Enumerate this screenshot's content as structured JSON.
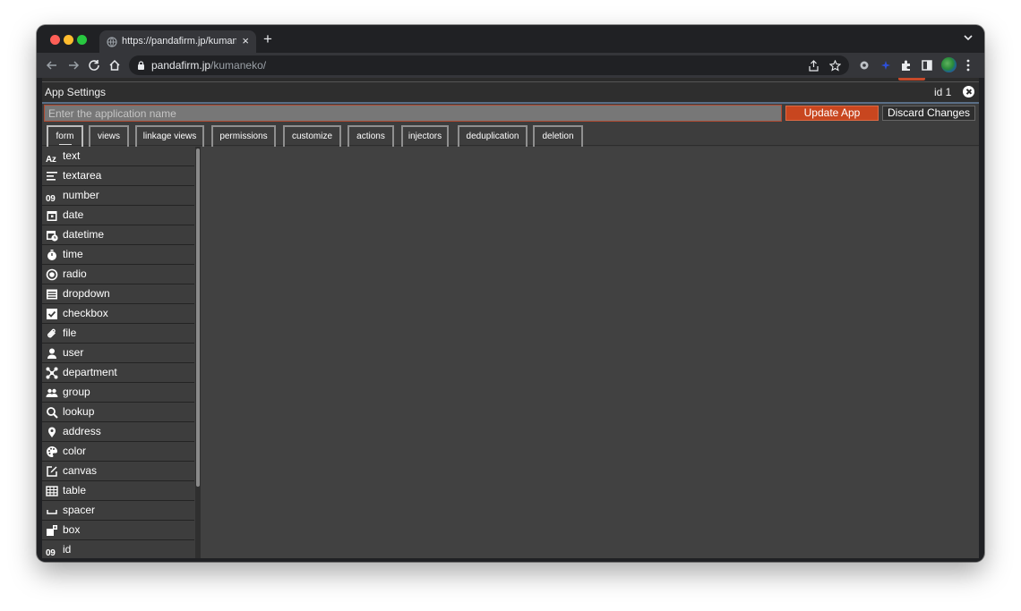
{
  "browser": {
    "tab_title": "https://pandafirm.jp/kumaneko/",
    "tab_close": "×",
    "new_tab": "+",
    "url_host": "pandafirm.jp",
    "url_path": "/kumaneko/"
  },
  "app": {
    "title": "App Settings",
    "id_label": "id 1",
    "name_placeholder": "Enter the application name",
    "update_button": "Update App",
    "discard_button": "Discard Changes",
    "accent_color": "#c8461f"
  },
  "tabs": [
    {
      "label": "form",
      "active": true
    },
    {
      "label": "views"
    },
    {
      "label": "linkage views"
    },
    {
      "label": "permissions"
    },
    {
      "label": "customize"
    },
    {
      "label": "actions"
    },
    {
      "label": "injectors"
    },
    {
      "label": "deduplication"
    },
    {
      "label": "deletion"
    }
  ],
  "fields": [
    {
      "label": "text",
      "icon": "text-az-icon",
      "glyph": "Az"
    },
    {
      "label": "textarea",
      "icon": "textarea-lines-icon"
    },
    {
      "label": "number",
      "icon": "number-09-icon",
      "glyph": "09"
    },
    {
      "label": "date",
      "icon": "calendar-icon"
    },
    {
      "label": "datetime",
      "icon": "calendar-clock-icon"
    },
    {
      "label": "time",
      "icon": "stopwatch-icon"
    },
    {
      "label": "radio",
      "icon": "radio-icon"
    },
    {
      "label": "dropdown",
      "icon": "dropdown-list-icon"
    },
    {
      "label": "checkbox",
      "icon": "checkbox-icon"
    },
    {
      "label": "file",
      "icon": "paperclip-icon"
    },
    {
      "label": "user",
      "icon": "user-icon"
    },
    {
      "label": "department",
      "icon": "department-icon"
    },
    {
      "label": "group",
      "icon": "group-icon"
    },
    {
      "label": "lookup",
      "icon": "magnifier-icon"
    },
    {
      "label": "address",
      "icon": "map-pin-icon"
    },
    {
      "label": "color",
      "icon": "palette-icon"
    },
    {
      "label": "canvas",
      "icon": "edit-canvas-icon"
    },
    {
      "label": "table",
      "icon": "table-grid-icon"
    },
    {
      "label": "spacer",
      "icon": "spacer-icon"
    },
    {
      "label": "box",
      "icon": "box-icon"
    },
    {
      "label": "id",
      "icon": "id-09-icon",
      "glyph": "09"
    }
  ]
}
